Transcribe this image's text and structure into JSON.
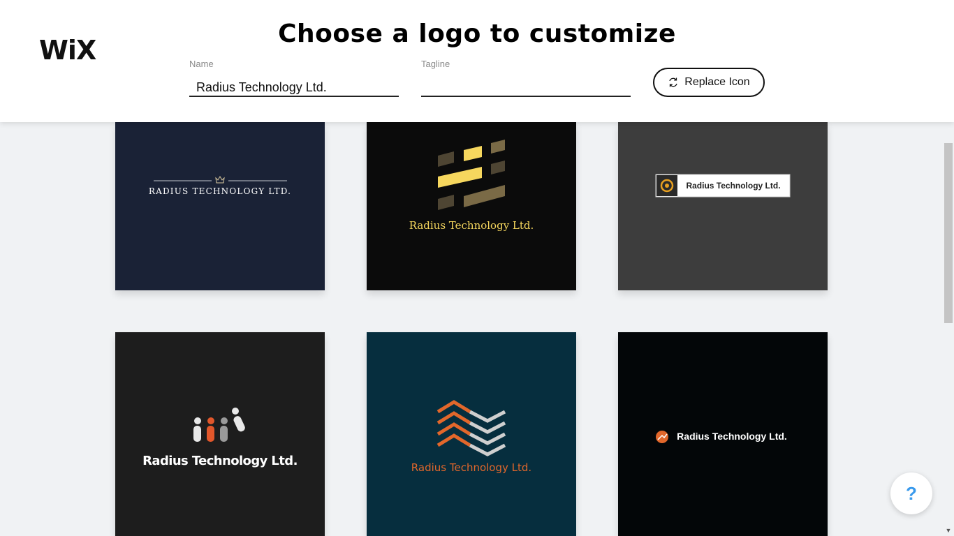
{
  "brand": {
    "logo_text": "WiX"
  },
  "header": {
    "title": "Choose a logo to customize"
  },
  "name_field": {
    "label": "Name",
    "value": "Radius Technology Ltd."
  },
  "tagline_field": {
    "label": "Tagline",
    "value": ""
  },
  "replace_icon": {
    "label": "Replace Icon",
    "icon": "refresh-icon"
  },
  "help": {
    "label": "?"
  },
  "colors": {
    "card1_bg": "#1a2236",
    "card2_bg": "#0b0b0b",
    "card3_bg": "#3d3d3d",
    "card4_bg": "#1d1d1d",
    "card5_bg": "#062e3e",
    "card6_bg": "#030608",
    "gold": "#f6d75e",
    "orange": "#e2672b",
    "help_blue": "#3899ec"
  },
  "logos": [
    {
      "text": "RADIUS TECHNOLOGY LTD.",
      "style": "serif small caps with crown divider"
    },
    {
      "text": "Radius Technology Ltd.",
      "style": "gold serif with bar icon"
    },
    {
      "text": "Radius Technology Ltd.",
      "style": "badge with orange icon"
    },
    {
      "text": "Radius Technology Ltd.",
      "style": "condensed bold with people icon"
    },
    {
      "text": "Radius Technology Ltd.",
      "style": "orange with chevron icon"
    },
    {
      "text": "Radius Technology Ltd.",
      "style": "white bold with orange circle icon"
    }
  ]
}
